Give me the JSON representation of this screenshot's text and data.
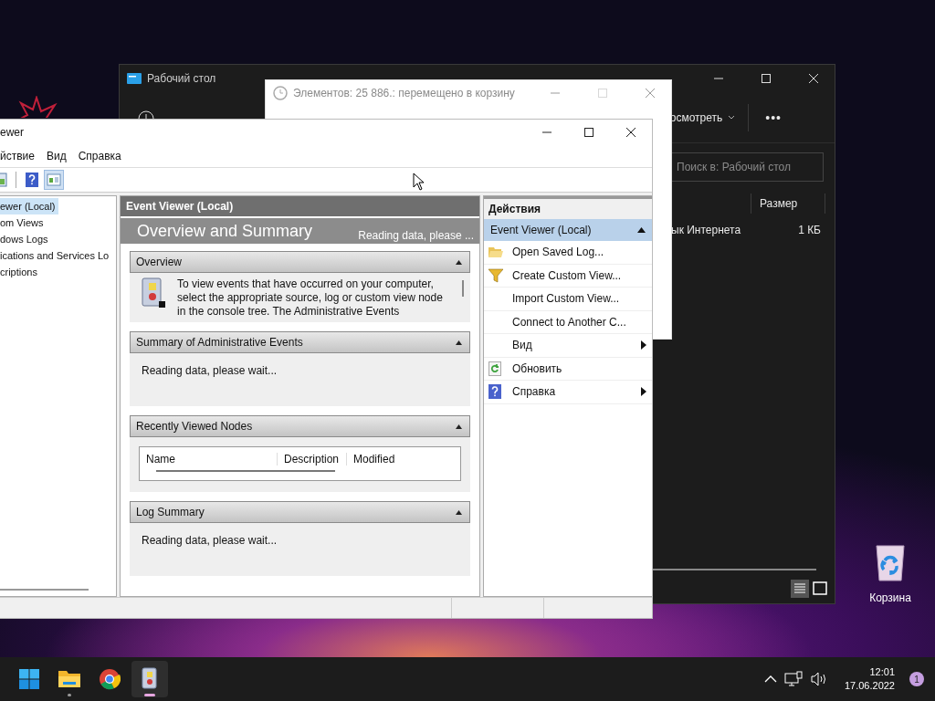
{
  "desktop": {
    "icons": [
      {
        "kind": "recycle-bin",
        "label": "Корзина"
      }
    ]
  },
  "explorer": {
    "title": "Рабочий стол",
    "view_button": "осмотреть",
    "more_button": "•••",
    "search": {
      "placeholder": "Поиск в: Рабочий стол"
    },
    "columns": [
      "Размер"
    ],
    "rows": [
      {
        "name": "ык Интернета",
        "size": "1 КБ"
      }
    ]
  },
  "progress_dialog": {
    "title": "Элементов: 25 886.: перемещено в корзину"
  },
  "event_viewer": {
    "title": "ewer",
    "menu": [
      "йствие",
      "Вид",
      "Справка"
    ],
    "tree": [
      {
        "label": "ewer (Local)",
        "selected": true
      },
      {
        "label": "om Views",
        "selected": false
      },
      {
        "label": "dows Logs",
        "selected": false
      },
      {
        "label": "ications and Services Lo",
        "selected": false
      },
      {
        "label": "criptions",
        "selected": false
      }
    ],
    "center": {
      "header": "Event Viewer (Local)",
      "title": "Overview and Summary",
      "status": "Reading data, please ...",
      "sections": [
        {
          "kind": "text",
          "title": "Overview",
          "text": "To view events that have occurred on your computer, select the appropriate source, log or custom view node in the console tree. The Administrative Events"
        },
        {
          "kind": "message",
          "title": "Summary of Administrative Events",
          "text": "Reading data, please wait..."
        },
        {
          "kind": "table",
          "title": "Recently Viewed Nodes",
          "columns": [
            "Name",
            "Description",
            "Modified"
          ]
        },
        {
          "kind": "message",
          "title": "Log Summary",
          "text": "Reading data, please wait..."
        }
      ]
    },
    "actions": {
      "title": "Действия",
      "group": "Event Viewer (Local)",
      "items": [
        {
          "label": "Open Saved Log...",
          "kind": "folder",
          "submenu": false
        },
        {
          "label": "Create Custom View...",
          "kind": "filter",
          "submenu": false
        },
        {
          "label": "Import Custom View...",
          "kind": "plain",
          "submenu": false
        },
        {
          "label": "Connect to Another C...",
          "kind": "plain",
          "submenu": false
        },
        {
          "label": "Вид",
          "kind": "plain",
          "submenu": true
        },
        {
          "label": "Обновить",
          "kind": "refresh",
          "submenu": false
        },
        {
          "label": "Справка",
          "kind": "help",
          "submenu": true
        }
      ]
    }
  },
  "taskbar": {
    "apps": [
      {
        "kind": "start",
        "running": false,
        "active": false
      },
      {
        "kind": "folder",
        "running": true,
        "active": false
      },
      {
        "kind": "browser",
        "running": false,
        "active": false
      },
      {
        "kind": "event-viewer",
        "running": true,
        "active": true
      }
    ],
    "time": "12:01",
    "date": "17.06.2022",
    "notifications": "1"
  }
}
